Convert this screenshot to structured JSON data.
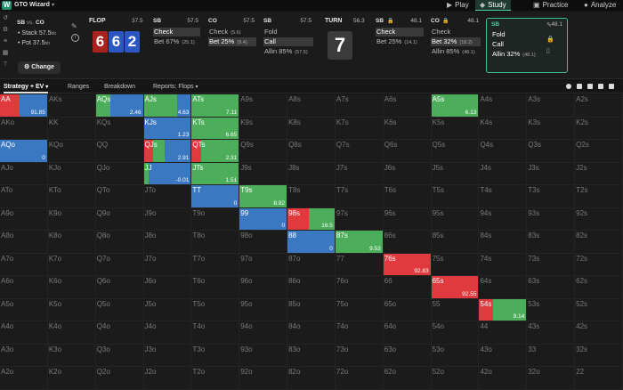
{
  "app": {
    "brand": "GTO Wizard",
    "nav": [
      {
        "label": "Play",
        "icon": "play-icon"
      },
      {
        "label": "Study",
        "icon": "graduation-cap-icon"
      },
      {
        "label": "Practice",
        "icon": "gamepad-icon"
      },
      {
        "label": "Analyze",
        "icon": "chart-icon"
      }
    ]
  },
  "spot": {
    "matchup_left": "SB",
    "matchup_vs": "vs.",
    "matchup_right": "CO",
    "stack": "• Stack 57.5",
    "stack_unit": "bb",
    "pot": "• Pot 37.5",
    "pot_unit": "bb",
    "change_label": "Change"
  },
  "flop": {
    "label": "FLOP",
    "pot": "37.5",
    "cards": [
      "6",
      "6",
      "2"
    ]
  },
  "columns": [
    {
      "pos": "SB",
      "stack": "57.5",
      "actions": [
        {
          "label": "Check",
          "size": "",
          "selected": true
        },
        {
          "label": "Bet 67%",
          "size": "(25.1)",
          "selected": false
        }
      ]
    },
    {
      "pos": "CO",
      "stack": "57.5",
      "actions": [
        {
          "label": "Check",
          "size": "(5.6)",
          "selected": false
        },
        {
          "label": "Bet 25%",
          "size": "(9.4)",
          "selected": true
        }
      ]
    },
    {
      "pos": "SB",
      "stack": "57.5",
      "actions": [
        {
          "label": "Fold",
          "size": "",
          "selected": false
        },
        {
          "label": "Call",
          "size": "",
          "selected": true
        },
        {
          "label": "Allin 85%",
          "size": "(57.5)",
          "selected": false
        }
      ]
    }
  ],
  "turn": {
    "label": "TURN",
    "pot": "56.3",
    "card": "7"
  },
  "columns2": [
    {
      "pos": "SB",
      "stack": "48.1",
      "actions": [
        {
          "label": "Check",
          "size": "",
          "selected": true
        },
        {
          "label": "Bet 25%",
          "size": "(14.1)",
          "selected": false
        }
      ]
    },
    {
      "pos": "CO",
      "stack": "48.1",
      "actions": [
        {
          "label": "Check",
          "size": "",
          "selected": false
        },
        {
          "label": "Bet 32%",
          "size": "(18.2)",
          "selected": true
        },
        {
          "label": "Allin 85%",
          "size": "(48.1)",
          "selected": false
        }
      ]
    }
  ],
  "active": {
    "pos": "SB",
    "stack": "48.1",
    "actions": [
      {
        "label": "Fold",
        "size": ""
      },
      {
        "label": "Call",
        "size": ""
      },
      {
        "label": "Allin 32%",
        "size": "(48.1)"
      }
    ]
  },
  "tabs": [
    "Strategy + EV",
    "Ranges",
    "Breakdown",
    "Reports: Flops"
  ],
  "colors": {
    "fold": "#3a78c2",
    "call": "#4cae5a",
    "raise": "#e0393e",
    "accent": "#4ad4a4"
  },
  "grid": {
    "rows": [
      [
        "AA",
        "AKs",
        "AQs",
        "AJs",
        "ATs",
        "A9s",
        "A8s",
        "A7s",
        "A6s",
        "A5s",
        "A4s",
        "A3s",
        "A2s"
      ],
      [
        "AKo",
        "KK",
        "KQs",
        "KJs",
        "KTs",
        "K9s",
        "K8s",
        "K7s",
        "K6s",
        "K5s",
        "K4s",
        "K3s",
        "K2s"
      ],
      [
        "AQo",
        "KQo",
        "QQ",
        "QJs",
        "QTs",
        "Q9s",
        "Q8s",
        "Q7s",
        "Q6s",
        "Q5s",
        "Q4s",
        "Q3s",
        "Q2s"
      ],
      [
        "AJo",
        "KJo",
        "QJo",
        "JJ",
        "JTs",
        "J9s",
        "J8s",
        "J7s",
        "J6s",
        "J5s",
        "J4s",
        "J3s",
        "J2s"
      ],
      [
        "ATo",
        "KTo",
        "QTo",
        "JTo",
        "TT",
        "T9s",
        "T8s",
        "T7s",
        "T6s",
        "T5s",
        "T4s",
        "T3s",
        "T2s"
      ],
      [
        "A9o",
        "K9o",
        "Q9o",
        "J9o",
        "T9o",
        "99",
        "98s",
        "97s",
        "96s",
        "95s",
        "94s",
        "93s",
        "92s"
      ],
      [
        "A8o",
        "K8o",
        "Q8o",
        "J8o",
        "T8o",
        "98o",
        "88",
        "87s",
        "86s",
        "85s",
        "84s",
        "83s",
        "82s"
      ],
      [
        "A7o",
        "K7o",
        "Q7o",
        "J7o",
        "T7o",
        "97o",
        "87o",
        "77",
        "76s",
        "75s",
        "74s",
        "73s",
        "72s"
      ],
      [
        "A6o",
        "K6o",
        "Q6o",
        "J6o",
        "T6o",
        "96o",
        "86o",
        "76o",
        "66",
        "65s",
        "64s",
        "63s",
        "62s"
      ],
      [
        "A5o",
        "K5o",
        "Q5o",
        "J5o",
        "T5o",
        "95o",
        "85o",
        "75o",
        "65o",
        "55",
        "54s",
        "53s",
        "52s"
      ],
      [
        "A4o",
        "K4o",
        "Q4o",
        "J4o",
        "T4o",
        "94o",
        "84o",
        "74o",
        "64o",
        "54o",
        "44",
        "43s",
        "42s"
      ],
      [
        "A3o",
        "K3o",
        "Q3o",
        "J3o",
        "T3o",
        "93o",
        "83o",
        "73o",
        "63o",
        "53o",
        "43o",
        "33",
        "32s"
      ],
      [
        "A2o",
        "K2o",
        "Q2o",
        "J2o",
        "T2o",
        "92o",
        "82o",
        "72o",
        "62o",
        "52o",
        "42o",
        "32o",
        "22"
      ]
    ],
    "hands": {
      "AA": {
        "ev": "91.85",
        "mix": [
          [
            "raise",
            0.42
          ],
          [
            "fold",
            0.58
          ]
        ]
      },
      "AQs": {
        "ev": "2.46",
        "mix": [
          [
            "call",
            0.3
          ],
          [
            "fold",
            0.7
          ]
        ]
      },
      "AJs": {
        "ev": "4.63",
        "mix": [
          [
            "call",
            0.7
          ],
          [
            "fold",
            0.3
          ]
        ]
      },
      "ATs": {
        "ev": "7.11",
        "mix": [
          [
            "call",
            1.0
          ]
        ]
      },
      "A5s": {
        "ev": "6.13",
        "mix": [
          [
            "call",
            1.0
          ]
        ]
      },
      "KJs": {
        "ev": "1.23",
        "mix": [
          [
            "fold",
            1.0
          ]
        ]
      },
      "KTs": {
        "ev": "6.65",
        "mix": [
          [
            "call",
            1.0
          ]
        ]
      },
      "AQo": {
        "ev": "0",
        "mix": [
          [
            "fold",
            1.0
          ]
        ]
      },
      "QJs": {
        "ev": "2.91",
        "mix": [
          [
            "raise",
            0.2
          ],
          [
            "call",
            0.25
          ],
          [
            "fold",
            0.55
          ]
        ]
      },
      "QTs": {
        "ev": "2.31",
        "mix": [
          [
            "raise",
            0.2
          ],
          [
            "call",
            0.8
          ]
        ]
      },
      "JJ": {
        "ev": "-0.01",
        "mix": [
          [
            "call",
            0.1
          ],
          [
            "fold",
            0.9
          ]
        ]
      },
      "JTs": {
        "ev": "1.51",
        "mix": [
          [
            "call",
            1.0
          ]
        ]
      },
      "TT": {
        "ev": "0",
        "mix": [
          [
            "fold",
            1.0
          ]
        ]
      },
      "T9s": {
        "ev": "8.92",
        "mix": [
          [
            "call",
            1.0
          ]
        ]
      },
      "99": {
        "ev": "0",
        "mix": [
          [
            "fold",
            1.0
          ]
        ]
      },
      "98s": {
        "ev": "16.5",
        "mix": [
          [
            "raise",
            0.45
          ],
          [
            "call",
            0.55
          ]
        ]
      },
      "88": {
        "ev": "0",
        "mix": [
          [
            "fold",
            1.0
          ]
        ]
      },
      "87s": {
        "ev": "9.53",
        "mix": [
          [
            "call",
            1.0
          ]
        ]
      },
      "76s": {
        "ev": "92.83",
        "mix": [
          [
            "raise",
            1.0
          ]
        ]
      },
      "65s": {
        "ev": "92.55",
        "mix": [
          [
            "raise",
            1.0
          ]
        ]
      },
      "54s": {
        "ev": "9.14",
        "mix": [
          [
            "raise",
            0.3
          ],
          [
            "call",
            0.7
          ]
        ]
      }
    }
  }
}
